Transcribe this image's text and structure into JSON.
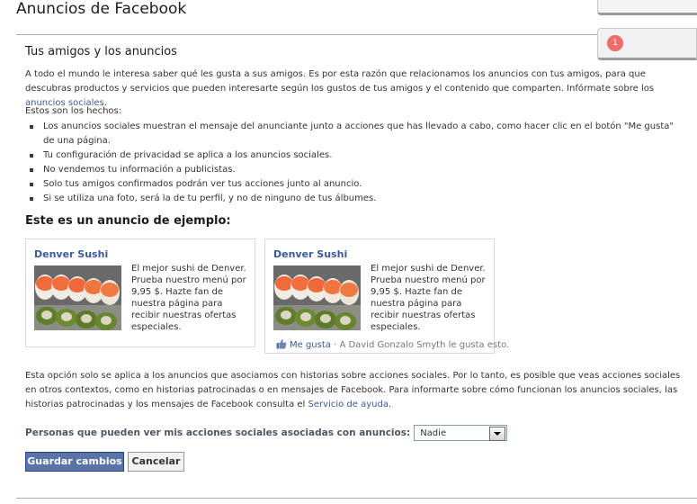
{
  "page": {
    "title": "Anuncios de Facebook"
  },
  "notifications": {
    "count": "1"
  },
  "section": {
    "title": "Tus amigos y los anuncios",
    "intro_text": "A todo el mundo le interesa saber qué les gusta a sus amigos. Es por esta razón que relacionamos los anuncios con tus amigos, para que descubras productos y servicios que pueden interesarte según los gustos de tus amigos y el contenido que comparten. Infórmate sobre los ",
    "intro_link": "anuncios sociales",
    "intro_end": "."
  },
  "facts": {
    "heading": "Estos son los hechos:",
    "items": [
      "Los anuncios sociales muestran el mensaje del anunciante junto a acciones que has llevado a cabo, como hacer clic en el botón \"Me gusta\" de una página.",
      "Tu configuración de privacidad se aplica a los anuncios sociales.",
      "No vendemos tu información a publicistas.",
      "Solo tus amigos confirmados podrán ver tus acciones junto al anuncio.",
      "Si se utiliza una foto, será la de tu perfil, y no de ninguno de tus álbumes."
    ]
  },
  "example": {
    "title": "Este es un anuncio de ejemplo:",
    "ads": [
      {
        "title": "Denver Sushi",
        "body": "El mejor sushi de Denver. Prueba nuestro menú por 9,95 $. Hazte fan de nuestra página para recibir nuestras ofertas especiales."
      },
      {
        "title": "Denver Sushi",
        "body": "El mejor sushi de Denver. Prueba nuestro menú por 9,95 $. Hazte fan de nuestra página para recibir nuestras ofertas especiales.",
        "like_label": "Me gusta",
        "like_text": " · A David Gonzalo Smyth le gusta esto."
      }
    ]
  },
  "note": {
    "text": "Esta opción solo se aplica a los anuncios que asociamos con historias sobre acciones sociales. Por lo tanto, es posible que veas acciones sociales en otros contextos, como en historias patrocinadas o en mensajes de Facebook. Para informarte sobre cómo funcionan los anuncios sociales, las historias patrocinadas y los mensajes de Facebook consulta el ",
    "link": "Servicio de ayuda",
    "end": "."
  },
  "privacy": {
    "label": "Personas que pueden ver mis acciones sociales asociadas con anuncios:",
    "selected": "Nadie"
  },
  "buttons": {
    "save": "Guardar cambios",
    "cancel": "Cancelar"
  },
  "colors": {
    "link": "#3b5998",
    "save_button": "#5b74a8",
    "badge": "#f26c6c"
  },
  "icons": {
    "like": "thumbs-up-icon",
    "dropdown": "chevron-down-icon"
  }
}
